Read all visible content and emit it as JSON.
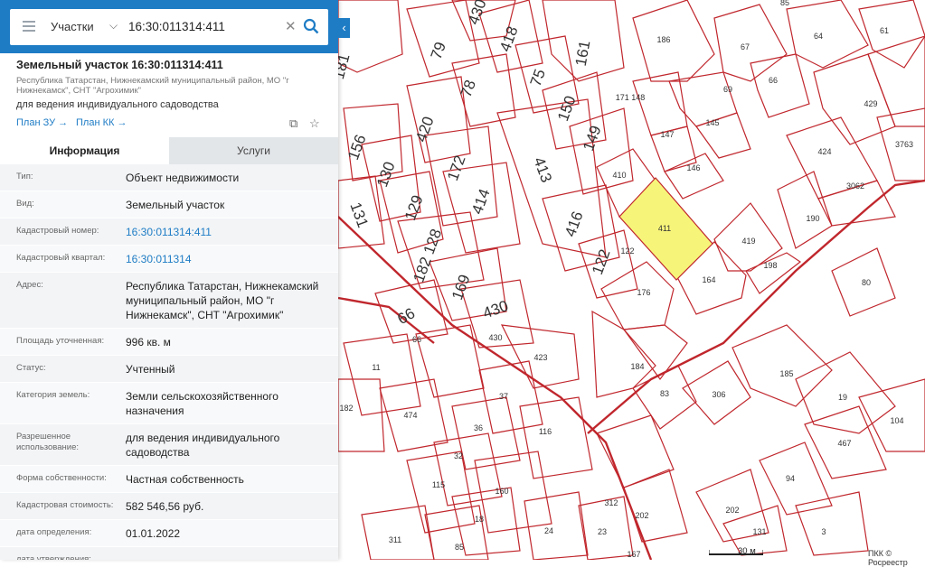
{
  "search": {
    "layer": "Участки",
    "query": "16:30:011314:411"
  },
  "header": {
    "title": "Земельный участок 16:30:011314:411",
    "address_short": "Республика Татарстан, Нижнекамский муниципальный район, МО \"г Нижнекамск\", СНТ \"Агрохимик\"",
    "purpose": "для ведения индивидуального садоводства",
    "plan_zu": "План ЗУ →",
    "plan_kk": "План КК →"
  },
  "tabs": {
    "info": "Информация",
    "services": "Услуги"
  },
  "info_rows": [
    {
      "label": "Тип:",
      "value": "Объект недвижимости"
    },
    {
      "label": "Вид:",
      "value": "Земельный участок"
    },
    {
      "label": "Кадастровый номер:",
      "value": "16:30:011314:411"
    },
    {
      "label": "Кадастровый квартал:",
      "value": "16:30:011314"
    },
    {
      "label": "Адрес:",
      "value": "Республика Татарстан, Нижнекамский муниципальный район, МО \"г Нижнекамск\", СНТ \"Агрохимик\""
    },
    {
      "label": "Площадь уточненная:",
      "value": "996 кв. м"
    },
    {
      "label": "Статус:",
      "value": "Учтенный"
    },
    {
      "label": "Категория земель:",
      "value": "Земли сельскохозяйственного назначения"
    },
    {
      "label": "Разрешенное использование:",
      "value": "для ведения индивидуального садоводства"
    },
    {
      "label": "Форма собственности:",
      "value": "Частная собственность"
    },
    {
      "label": "Кадастровая стоимость:",
      "value": "582 546,56 руб."
    },
    {
      "label": "дата определения:",
      "value": "01.01.2022"
    },
    {
      "label": "дата утверждения:",
      "value": "-"
    }
  ],
  "map": {
    "scale": "30 м",
    "copyright": "ПКК © Росреестр",
    "selected_parcel": "411",
    "parcel_color": "#c0272d",
    "selected_fill": "#f7f47a",
    "labels_large": [
      "181",
      "79",
      "430",
      "418",
      "161",
      "75",
      "78",
      "156",
      "420",
      "150",
      "130",
      "172",
      "413",
      "149",
      "129",
      "414",
      "131",
      "416",
      "122",
      "182 128",
      "169",
      "66",
      "430"
    ],
    "labels_small": [
      "85",
      "186",
      "67",
      "64",
      "61",
      "69",
      "66",
      "171 148",
      "429",
      "147",
      "145",
      "424",
      "3763",
      "146",
      "410",
      "3062",
      "411",
      "419",
      "190",
      "122",
      "164",
      "198",
      "80",
      "176",
      "66",
      "430",
      "423",
      "11",
      "184",
      "185",
      "306",
      "83",
      "19",
      "37",
      "182",
      "474",
      "104",
      "36",
      "116",
      "467",
      "32",
      "115",
      "160",
      "94",
      "312",
      "202",
      "202",
      "18",
      "131",
      "24",
      "23",
      "3",
      "311",
      "85",
      "167",
      "23"
    ]
  }
}
